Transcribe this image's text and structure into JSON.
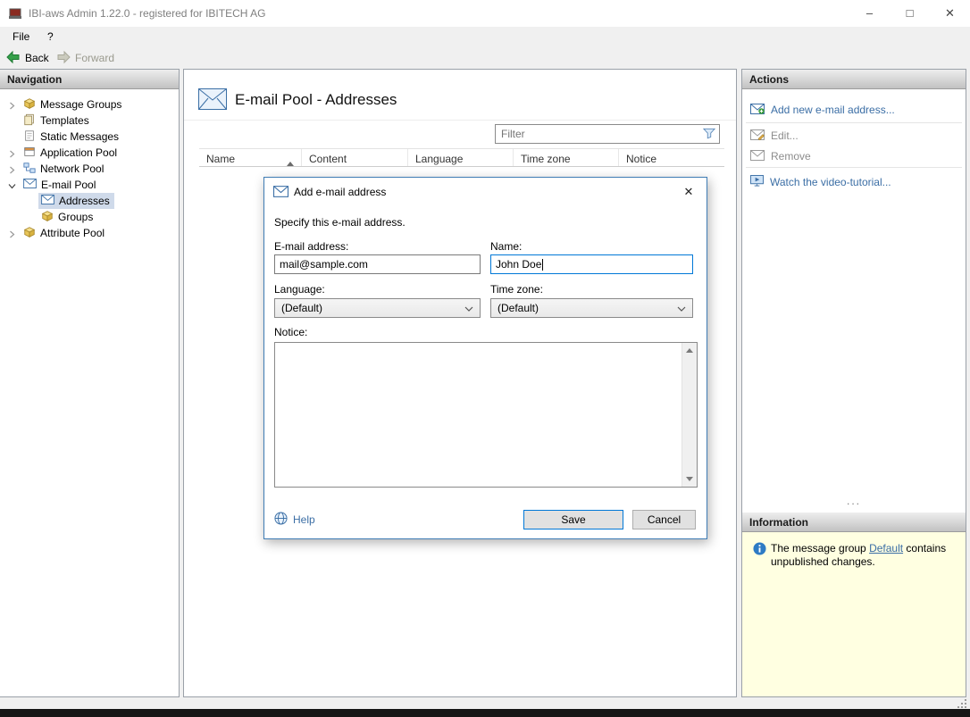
{
  "window": {
    "title": "IBI-aws Admin 1.22.0 - registered for IBITECH AG",
    "controls": {
      "minimize": "–",
      "maximize": "□",
      "close": "✕"
    }
  },
  "menu": {
    "file": "File",
    "help": "?"
  },
  "toolbar": {
    "back": "Back",
    "forward": "Forward"
  },
  "navigation": {
    "header": "Navigation",
    "items": [
      {
        "label": "Message Groups"
      },
      {
        "label": "Templates"
      },
      {
        "label": "Static Messages"
      },
      {
        "label": "Application Pool"
      },
      {
        "label": "Network Pool"
      },
      {
        "label": "E-mail Pool"
      },
      {
        "label": "Addresses"
      },
      {
        "label": "Groups"
      },
      {
        "label": "Attribute Pool"
      }
    ]
  },
  "main": {
    "title": "E-mail Pool - Addresses",
    "filter_placeholder": "Filter",
    "columns": [
      "Name",
      "Content",
      "Language",
      "Time zone",
      "Notice"
    ]
  },
  "dialog": {
    "title": "Add e-mail address",
    "close": "✕",
    "description": "Specify this e-mail address.",
    "email_label": "E-mail address:",
    "email_value": "mail@sample.com",
    "name_label": "Name:",
    "name_value": "John Doe",
    "language_label": "Language:",
    "language_value": "(Default)",
    "timezone_label": "Time zone:",
    "timezone_value": "(Default)",
    "notice_label": "Notice:",
    "help": "Help",
    "save": "Save",
    "cancel": "Cancel"
  },
  "actions": {
    "header": "Actions",
    "add": "Add new e-mail address...",
    "edit": "Edit...",
    "remove": "Remove",
    "tutorial": "Watch the video-tutorial...",
    "overflow": "..."
  },
  "information": {
    "header": "Information",
    "text_before": "The message group ",
    "link": "Default",
    "text_after": " contains unpublished changes."
  },
  "colors": {
    "link_blue": "#3b6ea5",
    "disabled_text": "#8c8c8c",
    "info_panel_bg": "#ffffe1",
    "focus_border": "#0078d7",
    "selected_item_bg": "#cfdaea"
  }
}
